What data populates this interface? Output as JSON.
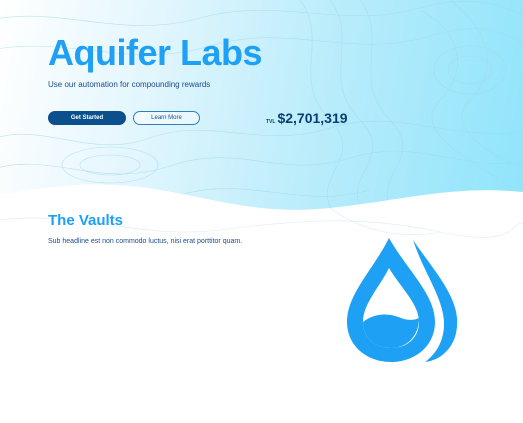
{
  "hero": {
    "title": "Aquifer Labs",
    "subtitle": "Use our automation for compounding rewards",
    "primary_button": "Get Started",
    "secondary_button": "Learn More",
    "tvl_label": "TVL",
    "tvl_value": "$2,701,319"
  },
  "vaults": {
    "title": "The Vaults",
    "subtitle": "Sub headline est non commodo luctus, nisi erat porttitor quam."
  },
  "colors": {
    "accent": "#1ea0f5",
    "navy": "#0b4f8d",
    "text": "#1a4d8c"
  },
  "icons": [
    "water-drops-icon"
  ]
}
